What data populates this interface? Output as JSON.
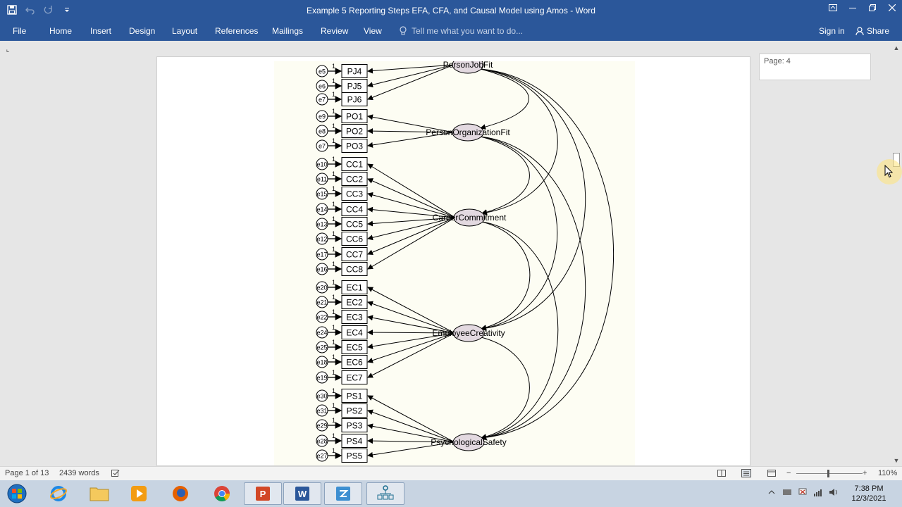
{
  "window": {
    "title": "Example 5 Reporting Steps EFA, CFA,  and Causal Model using Amos - Word"
  },
  "ribbon": {
    "tabs": [
      "File",
      "Home",
      "Insert",
      "Design",
      "Layout",
      "References",
      "Mailings",
      "Review",
      "View"
    ],
    "tell_me_placeholder": "Tell me what you want to do...",
    "sign_in": "Sign in",
    "share": "Share"
  },
  "document": {
    "page_tooltip": "Page: 4",
    "figure": {
      "latent_variables": [
        "PersonJobFit",
        "PersonOrganizationFit",
        "CareerCommitment",
        "EmployeeCreativity",
        "PsychologicalSafety"
      ],
      "indicators": {
        "PersonJobFit": [
          "PJ4",
          "PJ5",
          "PJ6"
        ],
        "PersonOrganizationFit": [
          "PO1",
          "PO2",
          "PO3"
        ],
        "CareerCommitment": [
          "CC1",
          "CC2",
          "CC3",
          "CC4",
          "CC5",
          "CC6",
          "CC7",
          "CC8"
        ],
        "EmployeeCreativity": [
          "EC1",
          "EC2",
          "EC3",
          "EC4",
          "EC5",
          "EC6",
          "EC7"
        ],
        "PsychologicalSafety": [
          "PS1",
          "PS2",
          "PS3",
          "PS4",
          "PS5"
        ]
      },
      "error_labels": [
        "e5",
        "e6",
        "e7",
        "e9",
        "e8",
        "e7",
        "e10",
        "e11",
        "e15",
        "e14",
        "e13",
        "e12",
        "e17",
        "e16",
        "e20",
        "e21",
        "e22",
        "e24",
        "e25",
        "e18",
        "e19",
        "e30",
        "e31",
        "e29",
        "e28",
        "e27"
      ],
      "path_label": "1"
    }
  },
  "status": {
    "page": "Page 1 of 13",
    "words": "2439 words",
    "zoom": "110%"
  },
  "taskbar": {
    "apps": [
      "start-orb",
      "internet-explorer",
      "file-explorer",
      "media-player",
      "firefox",
      "chrome",
      "powerpoint",
      "word",
      "spss",
      "amos"
    ],
    "time": "7:38 PM",
    "date": "12/3/2021"
  },
  "colors": {
    "accent": "#2b579a",
    "figure_bg": "#fdfdf3",
    "latent_fill": "#e3d9e0"
  }
}
